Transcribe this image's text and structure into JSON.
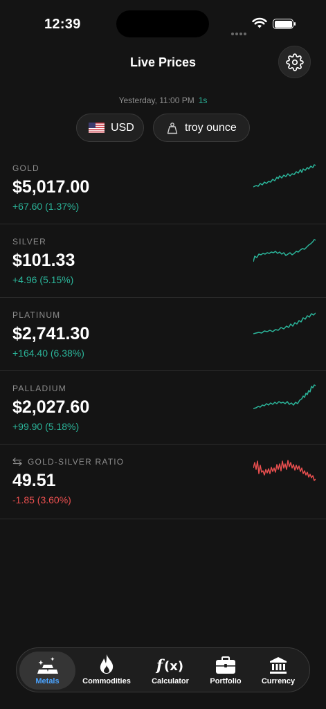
{
  "status": {
    "time": "12:39"
  },
  "header": {
    "title": "Live Prices",
    "settings_icon": "gear-icon"
  },
  "updated": {
    "text": "Yesterday, 11:00 PM",
    "ago": "1s"
  },
  "selectors": {
    "currency": "USD",
    "unit": "troy ounce"
  },
  "colors": {
    "up": "#2bb59a",
    "down": "#e94f4f",
    "accent": "#4aa3ff",
    "background": "#141414"
  },
  "metals": [
    {
      "label": "GOLD",
      "price": "$5,017.00",
      "change": "+67.60 (1.37%)",
      "direction": "up"
    },
    {
      "label": "SILVER",
      "price": "$101.33",
      "change": "+4.96 (5.15%)",
      "direction": "up"
    },
    {
      "label": "PLATINUM",
      "price": "$2,741.30",
      "change": "+164.40 (6.38%)",
      "direction": "up"
    },
    {
      "label": "PALLADIUM",
      "price": "$2,027.60",
      "change": "+99.90 (5.18%)",
      "direction": "up"
    },
    {
      "label": "GOLD-SILVER RATIO",
      "price": "49.51",
      "change": "-1.85 (3.60%)",
      "direction": "down"
    }
  ],
  "tabs": [
    {
      "label": "Metals",
      "icon": "gold-bars-icon",
      "active": true
    },
    {
      "label": "Commodities",
      "icon": "flame-icon",
      "active": false
    },
    {
      "label": "Calculator",
      "icon": "function-icon",
      "active": false
    },
    {
      "label": "Portfolio",
      "icon": "briefcase-icon",
      "active": false
    },
    {
      "label": "Currency",
      "icon": "bank-icon",
      "active": false
    }
  ]
}
